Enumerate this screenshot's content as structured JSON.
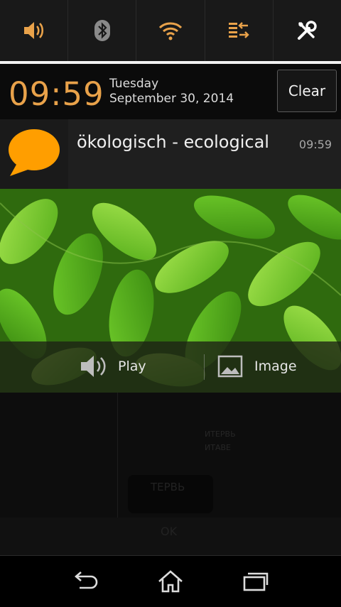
{
  "quick_settings": {
    "buttons": [
      {
        "name": "sound-icon"
      },
      {
        "name": "bluetooth-icon"
      },
      {
        "name": "wifi-icon"
      },
      {
        "name": "data-sync-icon"
      },
      {
        "name": "settings-tools-icon"
      }
    ],
    "accent": "#e9a24a"
  },
  "header": {
    "time": "09:59",
    "day": "Tuesday",
    "date": "September 30, 2014",
    "clear_label": "Clear"
  },
  "notification": {
    "icon": "speech-bubble-icon",
    "icon_color": "#ff9e00",
    "title": "ökologisch - ecological",
    "time": "09:59",
    "actions": [
      {
        "icon": "speaker-icon",
        "label": "Play"
      },
      {
        "icon": "image-icon",
        "label": "Image"
      }
    ]
  },
  "background_ghost": {
    "line1": "ИТЕРВЬ",
    "line2": "ИТАВЕ",
    "line3": "ТЕРВЬ",
    "ok": "OK"
  },
  "navbar": {
    "buttons": [
      {
        "name": "back-icon"
      },
      {
        "name": "home-icon"
      },
      {
        "name": "recent-apps-icon"
      }
    ]
  }
}
